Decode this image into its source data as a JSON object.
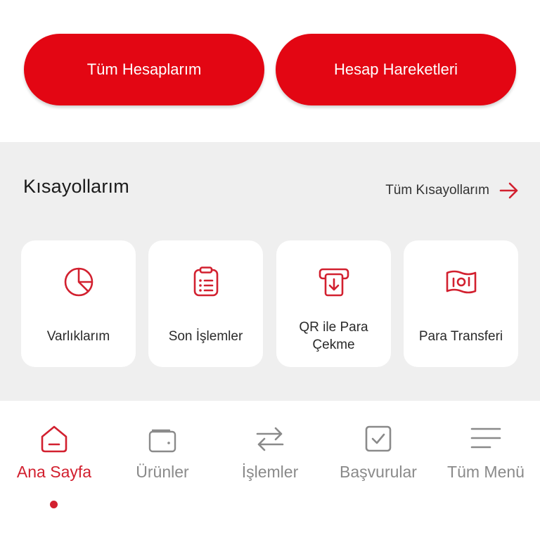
{
  "actions": {
    "all_accounts_label": "Tüm Hesaplarım",
    "account_transactions_label": "Hesap Hareketleri"
  },
  "shortcuts": {
    "title": "Kısayollarım",
    "all_link_label": "Tüm Kısayollarım",
    "items": [
      {
        "label": "Varlıklarım",
        "icon": "pie-chart-icon"
      },
      {
        "label": "Son İşlemler",
        "icon": "clipboard-list-icon"
      },
      {
        "label": "QR ile Para Çekme",
        "icon": "atm-withdraw-icon"
      },
      {
        "label": "Para Transferi",
        "icon": "banknote-icon"
      }
    ]
  },
  "bottom_nav": {
    "items": [
      {
        "label": "Ana Sayfa",
        "icon": "home-icon",
        "active": true
      },
      {
        "label": "Ürünler",
        "icon": "wallet-icon",
        "active": false
      },
      {
        "label": "İşlemler",
        "icon": "transfer-arrows-icon",
        "active": false
      },
      {
        "label": "Başvurular",
        "icon": "checkbox-icon",
        "active": false
      },
      {
        "label": "Tüm Menü",
        "icon": "menu-icon",
        "active": false
      }
    ]
  },
  "colors": {
    "brand_red": "#e30613",
    "icon_red": "#d2202f",
    "section_bg": "#efefef",
    "inactive_gray": "#8a8a8a"
  }
}
